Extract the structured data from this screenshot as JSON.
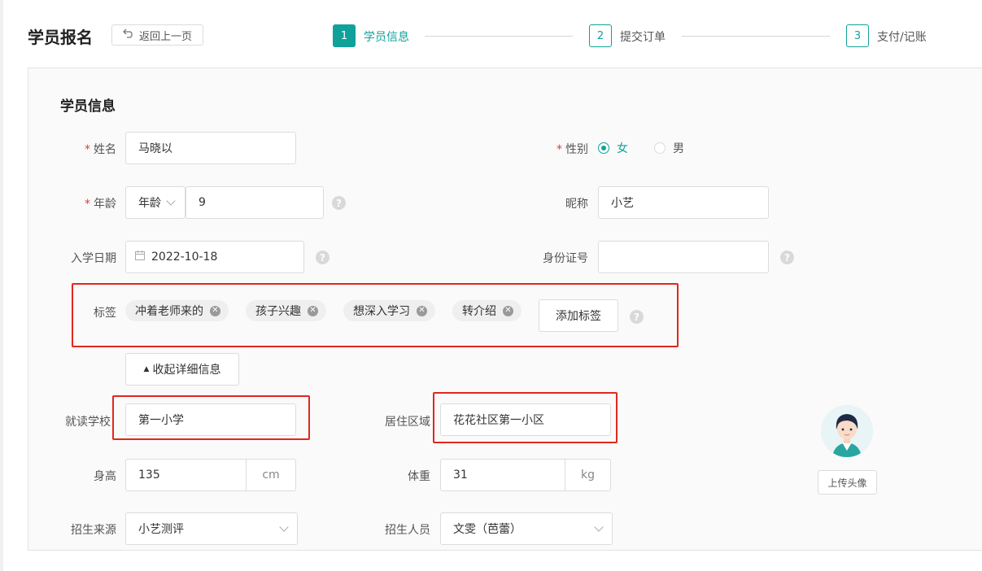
{
  "header": {
    "title": "学员报名",
    "back_label": "返回上一页",
    "steps": [
      {
        "num": "1",
        "label": "学员信息"
      },
      {
        "num": "2",
        "label": "提交订单"
      },
      {
        "num": "3",
        "label": "支付/记账"
      }
    ]
  },
  "form": {
    "section_title": "学员信息",
    "name": {
      "label": "姓名",
      "value": "马晓以"
    },
    "gender": {
      "label": "性别",
      "options": [
        "女",
        "男"
      ],
      "selected": "女"
    },
    "age": {
      "label": "年龄",
      "unit_select": "年龄",
      "value": "9",
      "help": "?"
    },
    "nickname": {
      "label": "昵称",
      "value": "小艺"
    },
    "enroll_date": {
      "label": "入学日期",
      "value": "2022-10-18",
      "help": "?"
    },
    "id_number": {
      "label": "身份证号",
      "value": "",
      "help": "?"
    },
    "tags": {
      "label": "标签",
      "items": [
        "冲着老师来的",
        "孩子兴趣",
        "想深入学习",
        "转介绍"
      ],
      "add_label": "添加标签",
      "help": "?"
    },
    "collapse_label": "收起详细信息",
    "school": {
      "label": "就读学校",
      "value": "第一小学"
    },
    "area": {
      "label": "居住区域",
      "value": "花花社区第一小区"
    },
    "height": {
      "label": "身高",
      "value": "135",
      "unit": "cm"
    },
    "weight": {
      "label": "体重",
      "value": "31",
      "unit": "kg"
    },
    "source": {
      "label": "招生来源",
      "value": "小艺测评"
    },
    "recruiter": {
      "label": "招生人员",
      "value": "文雯（芭蕾）"
    },
    "upload_avatar_label": "上传头像"
  },
  "colors": {
    "accent": "#10a19a",
    "required": "#e53935",
    "highlight_box": "#e0281e"
  }
}
